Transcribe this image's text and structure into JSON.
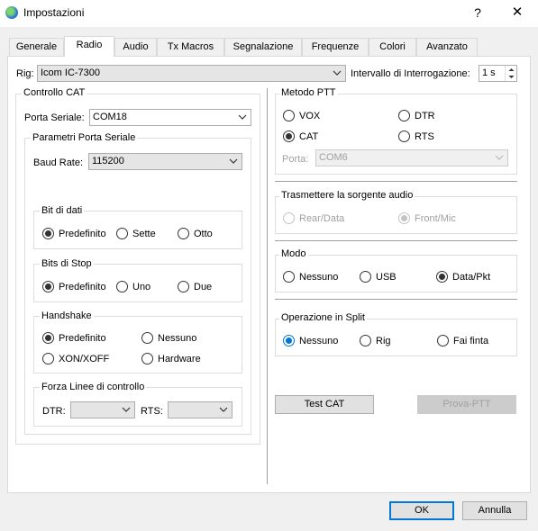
{
  "window": {
    "title": "Impostazioni",
    "help": "?",
    "close": "✕"
  },
  "tabs": [
    {
      "label": "Generale"
    },
    {
      "label": "Radio"
    },
    {
      "label": "Audio"
    },
    {
      "label": "Tx Macros"
    },
    {
      "label": "Segnalazione"
    },
    {
      "label": "Frequenze"
    },
    {
      "label": "Colori"
    },
    {
      "label": "Avanzato"
    }
  ],
  "active_tab": "Radio",
  "rig": {
    "label": "Rig:",
    "value": "Icom IC-7300"
  },
  "polling": {
    "label": "Intervallo di Interrogazione:",
    "value": "1 s"
  },
  "cat": {
    "title": "Controllo CAT",
    "serial_port_label": "Porta Seriale:",
    "serial_port_value": "COM18",
    "params_title": "Parametri Porta Seriale",
    "baud_label": "Baud Rate:",
    "baud_value": "115200",
    "data_bits": {
      "title": "Bit di dati",
      "options": [
        "Predefinito",
        "Sette",
        "Otto"
      ],
      "selected": "Predefinito"
    },
    "stop_bits": {
      "title": "Bits di Stop",
      "options": [
        "Predefinito",
        "Uno",
        "Due"
      ],
      "selected": "Predefinito"
    },
    "handshake": {
      "title": "Handshake",
      "options": [
        "Predefinito",
        "Nessuno",
        "XON/XOFF",
        "Hardware"
      ],
      "selected": "Predefinito"
    },
    "force_lines": {
      "title": "Forza Linee di controllo",
      "dtr_label": "DTR:",
      "dtr_value": "",
      "rts_label": "RTS:",
      "rts_value": ""
    }
  },
  "ptt": {
    "title": "Metodo PTT",
    "options": [
      "VOX",
      "DTR",
      "CAT",
      "RTS"
    ],
    "selected": "CAT",
    "port_label": "Porta:",
    "port_value": "COM6"
  },
  "audio_source": {
    "title": "Trasmettere la sorgente audio",
    "options": [
      "Rear/Data",
      "Front/Mic"
    ],
    "selected": "Front/Mic"
  },
  "mode": {
    "title": "Modo",
    "options": [
      "Nessuno",
      "USB",
      "Data/Pkt"
    ],
    "selected": "Data/Pkt"
  },
  "split": {
    "title": "Operazione in Split",
    "options": [
      "Nessuno",
      "Rig",
      "Fai finta"
    ],
    "selected": "Nessuno"
  },
  "buttons": {
    "test_cat": "Test CAT",
    "test_ptt": "Prova-PTT",
    "ok": "OK",
    "cancel": "Annulla"
  },
  "colors": {
    "accent": "#0078d7",
    "disabled_text": "#a0a0a0"
  }
}
